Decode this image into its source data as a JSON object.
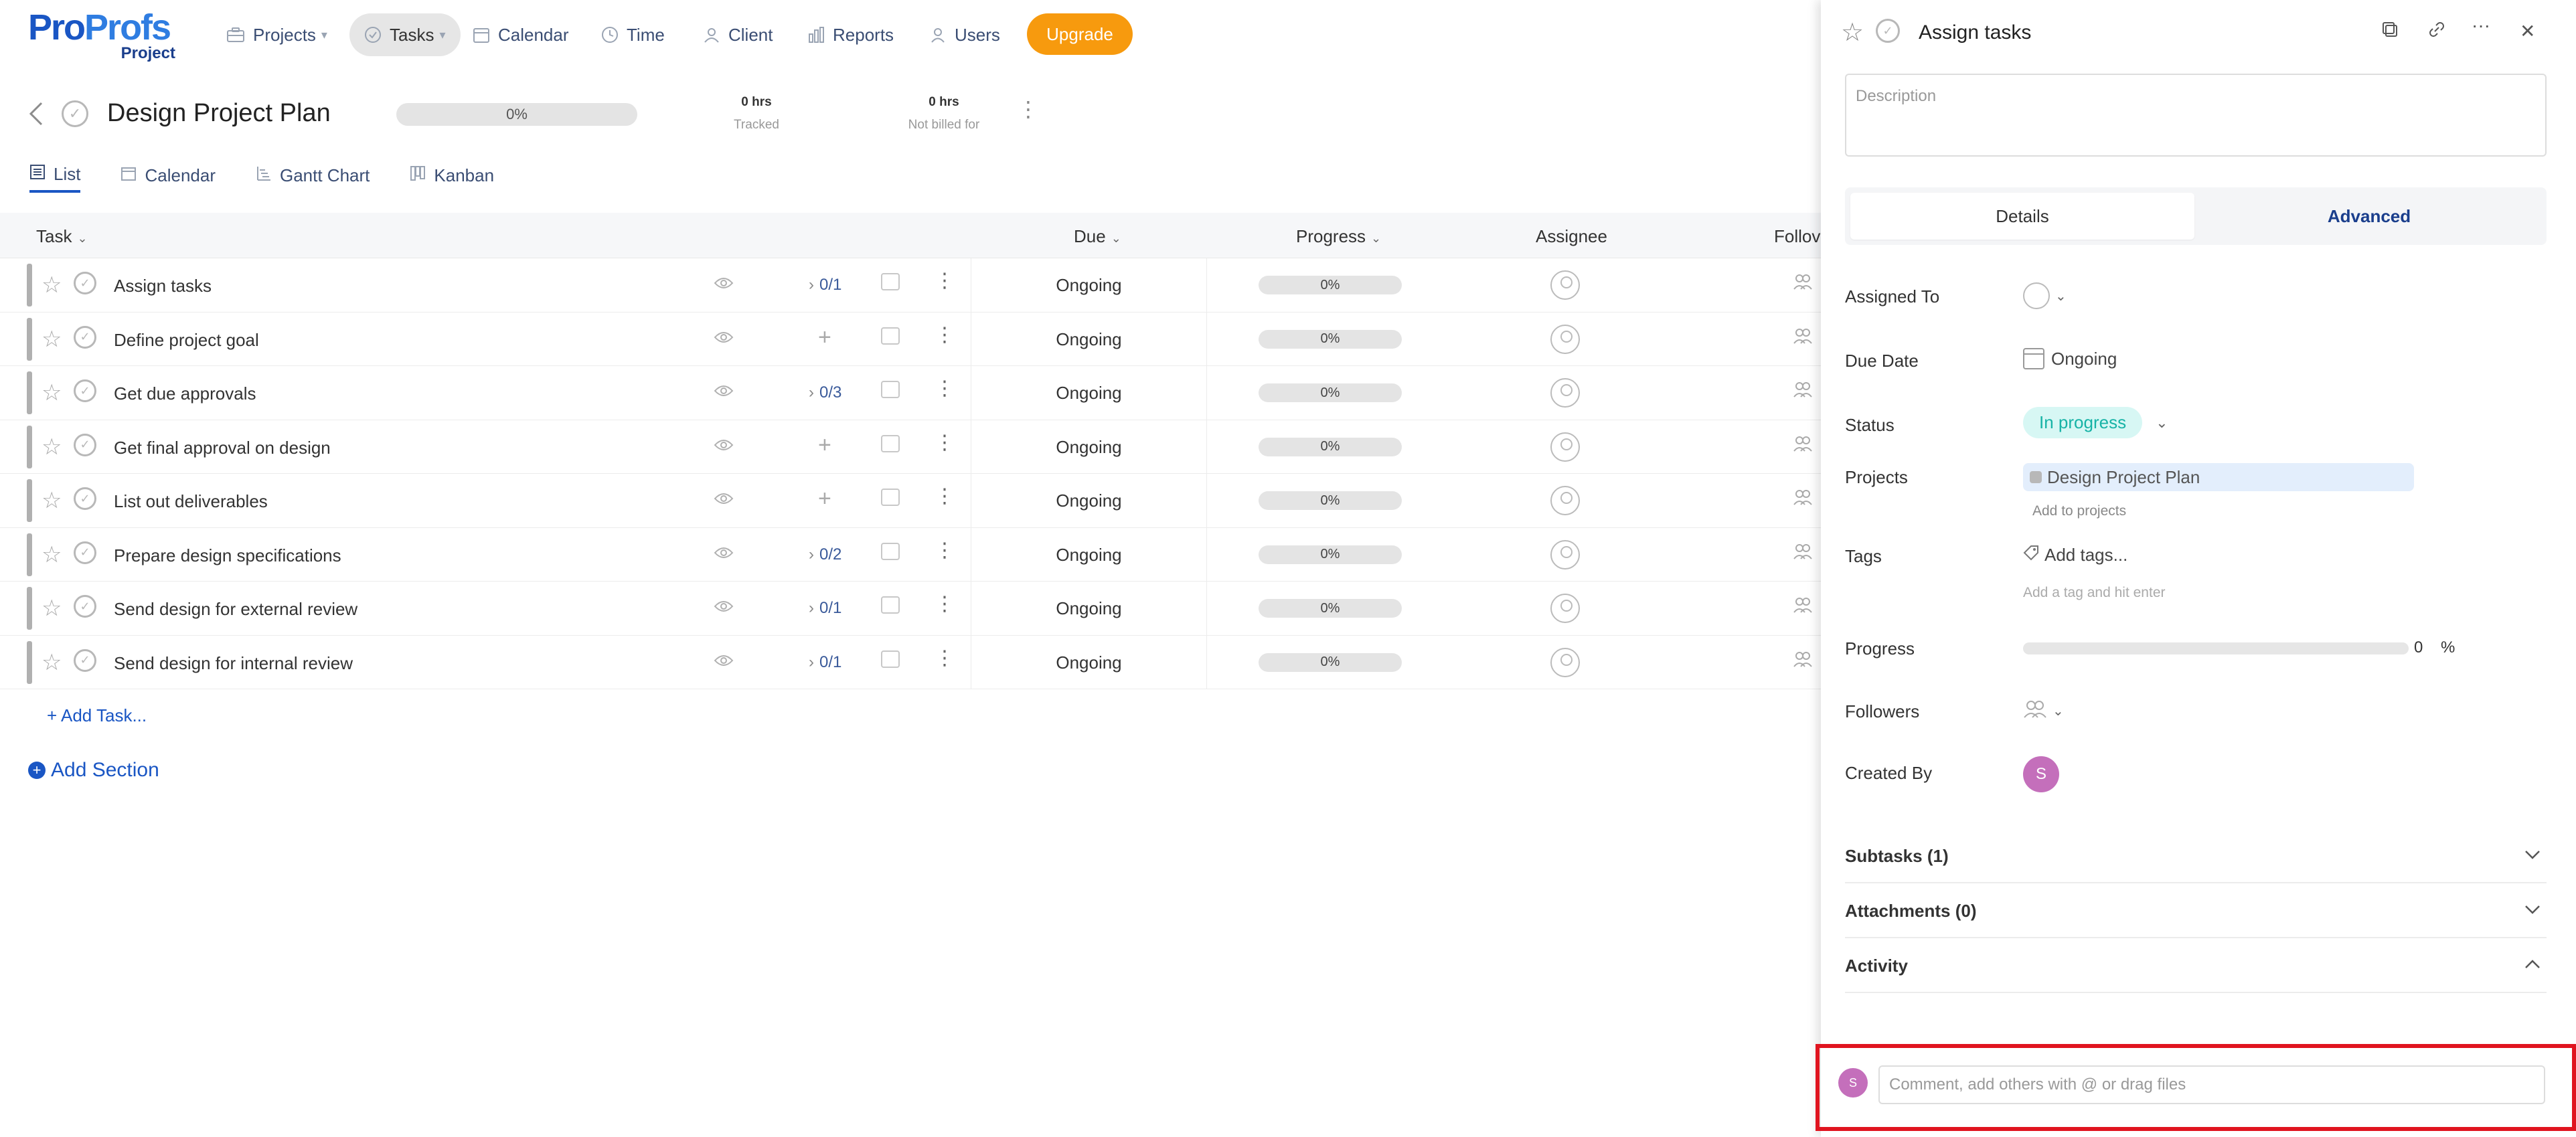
{
  "nav": {
    "logo_pro": "Pro",
    "logo_profs": "Profs",
    "logo_sub": "Project",
    "items": [
      {
        "label": "Projects",
        "icon": "briefcase-icon"
      },
      {
        "label": "Tasks",
        "icon": "check-circle-icon"
      },
      {
        "label": "Calendar",
        "icon": "calendar-icon"
      },
      {
        "label": "Time",
        "icon": "clock-icon"
      },
      {
        "label": "Client",
        "icon": "client-icon"
      },
      {
        "label": "Reports",
        "icon": "bar-chart-icon"
      },
      {
        "label": "Users",
        "icon": "user-icon"
      }
    ],
    "upgrade_label": "Upgrade"
  },
  "project": {
    "title": "Design Project Plan",
    "progress": "0%",
    "tracked_value": "0 hrs",
    "tracked_label": "Tracked",
    "billed_value": "0 hrs",
    "billed_label": "Not billed for"
  },
  "view_tabs": [
    "List",
    "Calendar",
    "Gantt Chart",
    "Kanban"
  ],
  "table": {
    "headers": {
      "task": "Task",
      "due": "Due",
      "progress": "Progress",
      "assignee": "Assignee",
      "followers": "Follov"
    },
    "rows": [
      {
        "name": "Assign tasks",
        "subtasks": "0/1",
        "due": "Ongoing",
        "progress": "0%"
      },
      {
        "name": "Define project goal",
        "subtasks": "",
        "due": "Ongoing",
        "progress": "0%"
      },
      {
        "name": "Get due approvals",
        "subtasks": "0/3",
        "due": "Ongoing",
        "progress": "0%"
      },
      {
        "name": "Get final approval on design",
        "subtasks": "",
        "due": "Ongoing",
        "progress": "0%"
      },
      {
        "name": "List out deliverables",
        "subtasks": "",
        "due": "Ongoing",
        "progress": "0%"
      },
      {
        "name": "Prepare design specifications",
        "subtasks": "0/2",
        "due": "Ongoing",
        "progress": "0%"
      },
      {
        "name": "Send design for external review",
        "subtasks": "0/1",
        "due": "Ongoing",
        "progress": "0%"
      },
      {
        "name": "Send design for internal review",
        "subtasks": "0/1",
        "due": "Ongoing",
        "progress": "0%"
      }
    ],
    "add_task": "+ Add Task...",
    "add_section": "Add Section"
  },
  "panel": {
    "title": "Assign tasks",
    "description_placeholder": "Description",
    "tabs": {
      "details": "Details",
      "advanced": "Advanced"
    },
    "fields": {
      "assigned_to": "Assigned To",
      "due_date": "Due Date",
      "due_value": "Ongoing",
      "status": "Status",
      "status_value": "In progress",
      "projects": "Projects",
      "project_value": "Design Project Plan",
      "add_to_projects": "Add to projects",
      "tags": "Tags",
      "add_tags": "Add tags...",
      "tag_hint": "Add a tag and hit enter",
      "progress": "Progress",
      "progress_value": "0",
      "progress_unit": "%",
      "followers": "Followers",
      "created_by": "Created By",
      "creator_initial": "S"
    },
    "sections": {
      "subtasks": "Subtasks (1)",
      "attachments": "Attachments (0)",
      "activity": "Activity"
    },
    "comment": {
      "avatar_initial": "S",
      "placeholder": "Comment, add others with @ or drag files"
    }
  },
  "colors": {
    "brand_blue": "#1a56c4",
    "upgrade_orange": "#f79a0e",
    "status_teal": "#17b3a6",
    "highlight_red": "#e0141f"
  }
}
